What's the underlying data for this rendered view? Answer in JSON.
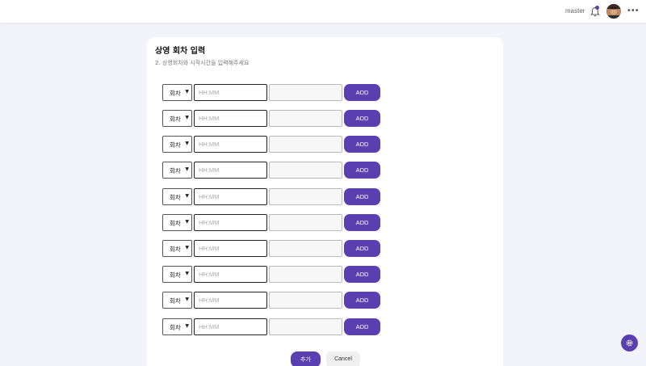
{
  "header": {
    "username": "master",
    "more_label": "•••",
    "icons": {
      "notification": "bell-icon",
      "avatar": "user-avatar",
      "more": "more-dots-icon"
    }
  },
  "card": {
    "title": "상영 회차 입력",
    "subtitle": "2. 상영회차와 시작시간을 입력해주세요",
    "rows": [
      {
        "select": "회차",
        "time_placeholder": "HH:MM",
        "add_label": "ADD"
      },
      {
        "select": "회차",
        "time_placeholder": "HH:MM",
        "add_label": "ADD"
      },
      {
        "select": "회차",
        "time_placeholder": "HH:MM",
        "add_label": "ADD"
      },
      {
        "select": "회차",
        "time_placeholder": "HH:MM",
        "add_label": "ADD"
      },
      {
        "select": "회차",
        "time_placeholder": "HH:MM",
        "add_label": "ADD"
      },
      {
        "select": "회차",
        "time_placeholder": "HH:MM",
        "add_label": "ADD"
      },
      {
        "select": "회차",
        "time_placeholder": "HH:MM",
        "add_label": "ADD"
      },
      {
        "select": "회차",
        "time_placeholder": "HH:MM",
        "add_label": "ADD"
      },
      {
        "select": "회차",
        "time_placeholder": "HH:MM",
        "add_label": "ADD"
      },
      {
        "select": "회차",
        "time_placeholder": "HH:MM",
        "add_label": "ADD"
      }
    ],
    "submit_label": "추가",
    "cancel_label": "Cancel"
  },
  "fab": {
    "icon": "settings-gear-icon"
  },
  "colors": {
    "accent": "#5a3fb0",
    "background": "#f3f3fb",
    "card": "#ffffff"
  }
}
